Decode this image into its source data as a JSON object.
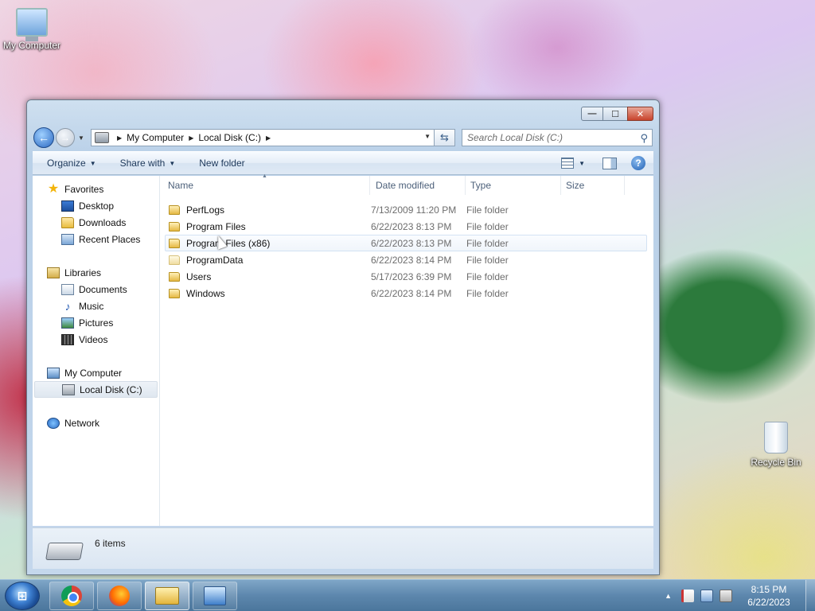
{
  "desktop": {
    "icons": [
      {
        "label": "My Computer"
      },
      {
        "label": "Recycle Bin"
      }
    ]
  },
  "window": {
    "controls": {
      "minimize": "—",
      "maximize": "☐",
      "close": "✕"
    },
    "address": {
      "crumbs": [
        "My Computer",
        "Local Disk (C:)"
      ]
    },
    "search": {
      "placeholder": "Search Local Disk (C:)"
    },
    "toolbar": {
      "organize": "Organize",
      "share_with": "Share with",
      "new_folder": "New folder"
    },
    "navpane": {
      "favorites": {
        "label": "Favorites",
        "items": [
          "Desktop",
          "Downloads",
          "Recent Places"
        ]
      },
      "libraries": {
        "label": "Libraries",
        "items": [
          "Documents",
          "Music",
          "Pictures",
          "Videos"
        ]
      },
      "computer": {
        "label": "My Computer",
        "items": [
          "Local Disk (C:)"
        ]
      },
      "network": {
        "label": "Network"
      }
    },
    "columns": {
      "name": "Name",
      "date": "Date modified",
      "type": "Type",
      "size": "Size"
    },
    "files": [
      {
        "name": "PerfLogs",
        "date": "7/13/2009 11:20 PM",
        "type": "File folder"
      },
      {
        "name": "Program Files",
        "date": "6/22/2023 8:13 PM",
        "type": "File folder"
      },
      {
        "name": "Program Files (x86)",
        "date": "6/22/2023 8:13 PM",
        "type": "File folder"
      },
      {
        "name": "ProgramData",
        "date": "6/22/2023 8:14 PM",
        "type": "File folder"
      },
      {
        "name": "Users",
        "date": "5/17/2023 6:39 PM",
        "type": "File folder"
      },
      {
        "name": "Windows",
        "date": "6/22/2023 8:14 PM",
        "type": "File folder"
      }
    ],
    "details": {
      "count": "6 items"
    }
  },
  "taskbar": {
    "apps": [
      "chrome-icon",
      "firefox-icon",
      "explorer-icon",
      "network-app-icon"
    ],
    "clock": {
      "time": "8:15 PM",
      "date": "6/22/2023"
    }
  }
}
